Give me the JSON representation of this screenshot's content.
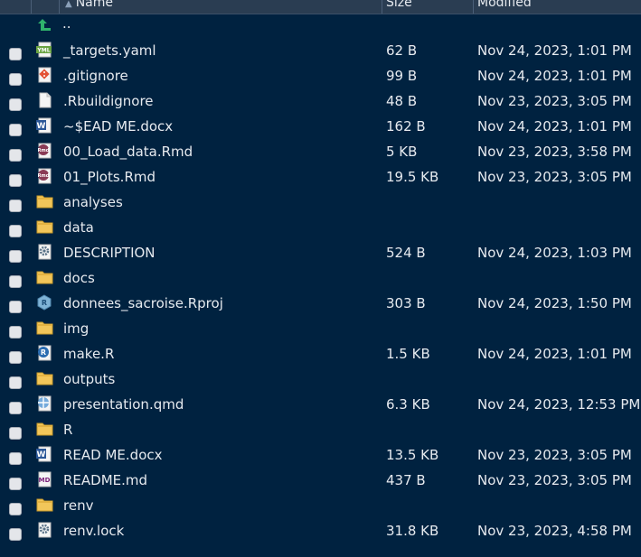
{
  "header": {
    "name": "Name",
    "size": "Size",
    "modified": "Modified"
  },
  "parent_row": {
    "label": ".."
  },
  "files": [
    {
      "name": "_targets.yaml",
      "icon": "yaml-file-icon",
      "size": "62 B",
      "modified": "Nov 24, 2023, 1:01 PM"
    },
    {
      "name": ".gitignore",
      "icon": "git-file-icon",
      "size": "99 B",
      "modified": "Nov 24, 2023, 1:01 PM"
    },
    {
      "name": ".Rbuildignore",
      "icon": "blank-file-icon",
      "size": "48 B",
      "modified": "Nov 23, 2023, 3:05 PM"
    },
    {
      "name": "~$EAD ME.docx",
      "icon": "word-file-icon",
      "size": "162 B",
      "modified": "Nov 24, 2023, 1:01 PM"
    },
    {
      "name": "00_Load_data.Rmd",
      "icon": "rmd-file-icon",
      "size": "5 KB",
      "modified": "Nov 23, 2023, 3:58 PM"
    },
    {
      "name": "01_Plots.Rmd",
      "icon": "rmd-file-icon",
      "size": "19.5 KB",
      "modified": "Nov 23, 2023, 3:05 PM"
    },
    {
      "name": "analyses",
      "icon": "folder-icon",
      "size": "",
      "modified": ""
    },
    {
      "name": "data",
      "icon": "folder-icon",
      "size": "",
      "modified": ""
    },
    {
      "name": "DESCRIPTION",
      "icon": "gear-file-icon",
      "size": "524 B",
      "modified": "Nov 24, 2023, 1:03 PM"
    },
    {
      "name": "docs",
      "icon": "folder-icon",
      "size": "",
      "modified": ""
    },
    {
      "name": "donnees_sacroise.Rproj",
      "icon": "rproj-file-icon",
      "size": "303 B",
      "modified": "Nov 24, 2023, 1:50 PM"
    },
    {
      "name": "img",
      "icon": "folder-icon",
      "size": "",
      "modified": ""
    },
    {
      "name": "make.R",
      "icon": "r-file-icon",
      "size": "1.5 KB",
      "modified": "Nov 24, 2023, 1:01 PM"
    },
    {
      "name": "outputs",
      "icon": "folder-icon",
      "size": "",
      "modified": ""
    },
    {
      "name": "presentation.qmd",
      "icon": "quarto-file-icon",
      "size": "6.3 KB",
      "modified": "Nov 24, 2023, 12:53 PM"
    },
    {
      "name": "R",
      "icon": "folder-icon",
      "size": "",
      "modified": ""
    },
    {
      "name": "READ ME.docx",
      "icon": "word-file-icon",
      "size": "13.5 KB",
      "modified": "Nov 23, 2023, 3:05 PM"
    },
    {
      "name": "README.md",
      "icon": "markdown-file-icon",
      "size": "437 B",
      "modified": "Nov 23, 2023, 3:05 PM"
    },
    {
      "name": "renv",
      "icon": "folder-icon",
      "size": "",
      "modified": ""
    },
    {
      "name": "renv.lock",
      "icon": "gear-file-icon",
      "size": "31.8 KB",
      "modified": "Nov 23, 2023, 4:58 PM"
    }
  ],
  "colors": {
    "background": "#002240",
    "header": "#2a3d52",
    "text": "#e6eaef",
    "folder": "#f2c65a",
    "up_arrow": "#2fb36c"
  }
}
